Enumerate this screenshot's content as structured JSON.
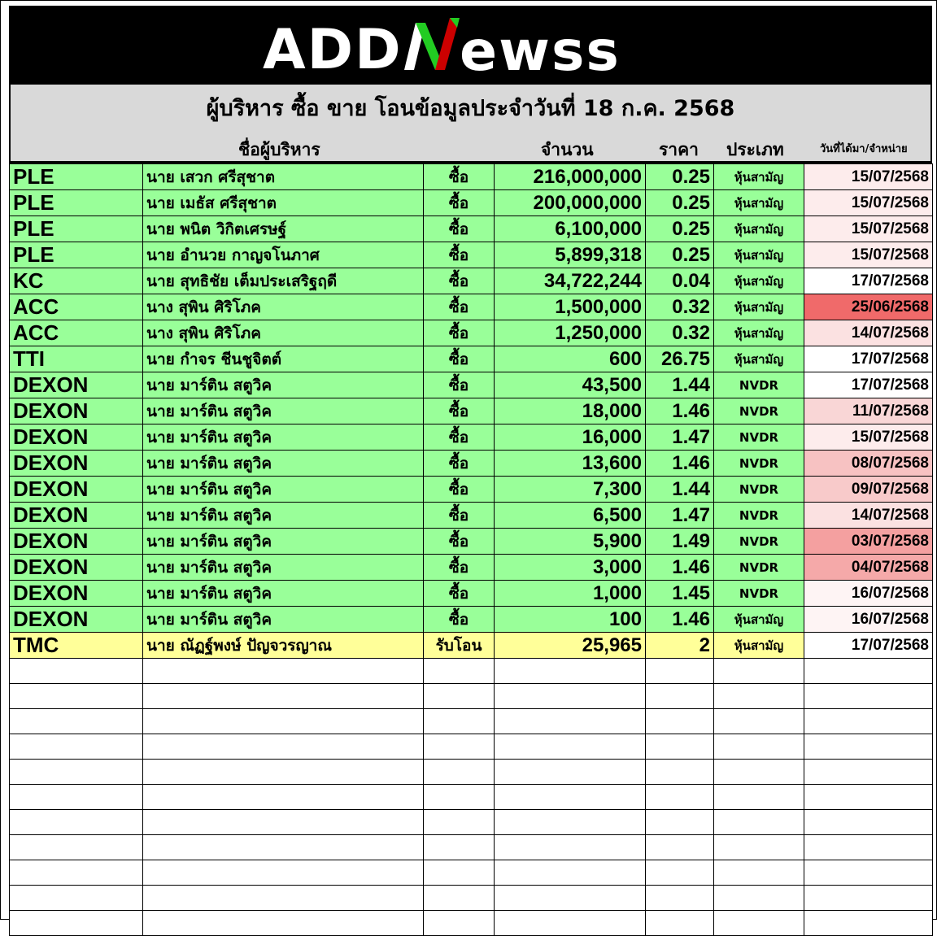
{
  "logo": {
    "text_left": "ADD",
    "text_right": "ewss",
    "colors": {
      "white": "#ffffff",
      "green": "#22cc22",
      "red": "#cc0000"
    }
  },
  "title": "ผู้บริหาร ซื้อ ขาย โอนข้อมูลประจำวันที่ 18 ก.ค. 2568",
  "headers": {
    "name": "ชื่อผู้บริหาร",
    "quantity": "จำนวน",
    "price": "ราคา",
    "type": "ประเภท",
    "date": "วันที่ได้มา/จำหน่าย"
  },
  "colors": {
    "buy_row": "#99ff99",
    "transfer_row": "#ffff99",
    "title_band": "#d9d9d9"
  },
  "rows": [
    {
      "symbol": "PLE",
      "name": "นาย เสวก ศรีสุชาต",
      "action": "ซื้อ",
      "quantity": "216,000,000",
      "price": "0.25",
      "type": "หุ้นสามัญ",
      "date": "15/07/2568",
      "date_color": "#fdecec",
      "kind": "buy"
    },
    {
      "symbol": "PLE",
      "name": "นาย เมธัส ศรีสุชาต",
      "action": "ซื้อ",
      "quantity": "200,000,000",
      "price": "0.25",
      "type": "หุ้นสามัญ",
      "date": "15/07/2568",
      "date_color": "#fdecec",
      "kind": "buy"
    },
    {
      "symbol": "PLE",
      "name": "นาย พนิต วิกิตเศรษฐ์",
      "action": "ซื้อ",
      "quantity": "6,100,000",
      "price": "0.25",
      "type": "หุ้นสามัญ",
      "date": "15/07/2568",
      "date_color": "#fdecec",
      "kind": "buy"
    },
    {
      "symbol": "PLE",
      "name": "นาย อำนวย กาญจโนภาศ",
      "action": "ซื้อ",
      "quantity": "5,899,318",
      "price": "0.25",
      "type": "หุ้นสามัญ",
      "date": "15/07/2568",
      "date_color": "#fdecec",
      "kind": "buy"
    },
    {
      "symbol": "KC",
      "name": "นาย สุทธิชัย เต็มประเสริฐฤดี",
      "action": "ซื้อ",
      "quantity": "34,722,244",
      "price": "0.04",
      "type": "หุ้นสามัญ",
      "date": "17/07/2568",
      "date_color": "#ffffff",
      "kind": "buy"
    },
    {
      "symbol": "ACC",
      "name": "นาง สุพิน ศิริโภค",
      "action": "ซื้อ",
      "quantity": "1,500,000",
      "price": "0.32",
      "type": "หุ้นสามัญ",
      "date": "25/06/2568",
      "date_color": "#f06a6a",
      "kind": "buy"
    },
    {
      "symbol": "ACC",
      "name": "นาง สุพิน ศิริโภค",
      "action": "ซื้อ",
      "quantity": "1,250,000",
      "price": "0.32",
      "type": "หุ้นสามัญ",
      "date": "14/07/2568",
      "date_color": "#fbe1e1",
      "kind": "buy"
    },
    {
      "symbol": "TTI",
      "name": "นาย กำจร ชีนชูจิตต์",
      "action": "ซื้อ",
      "quantity": "600",
      "price": "26.75",
      "type": "หุ้นสามัญ",
      "date": "17/07/2568",
      "date_color": "#ffffff",
      "kind": "buy"
    },
    {
      "symbol": "DEXON",
      "name": "นาย มาร์ติน สตูวิค",
      "action": "ซื้อ",
      "quantity": "43,500",
      "price": "1.44",
      "type": "NVDR",
      "date": "17/07/2568",
      "date_color": "#ffffff",
      "kind": "buy"
    },
    {
      "symbol": "DEXON",
      "name": "นาย มาร์ติน สตูวิค",
      "action": "ซื้อ",
      "quantity": "18,000",
      "price": "1.46",
      "type": "NVDR",
      "date": "11/07/2568",
      "date_color": "#f9d6d6",
      "kind": "buy"
    },
    {
      "symbol": "DEXON",
      "name": "นาย มาร์ติน สตูวิค",
      "action": "ซื้อ",
      "quantity": "16,000",
      "price": "1.47",
      "type": "NVDR",
      "date": "15/07/2568",
      "date_color": "#fdecec",
      "kind": "buy"
    },
    {
      "symbol": "DEXON",
      "name": "นาย มาร์ติน สตูวิค",
      "action": "ซื้อ",
      "quantity": "13,600",
      "price": "1.46",
      "type": "NVDR",
      "date": "08/07/2568",
      "date_color": "#f7c2c2",
      "kind": "buy"
    },
    {
      "symbol": "DEXON",
      "name": "นาย มาร์ติน สตูวิค",
      "action": "ซื้อ",
      "quantity": "7,300",
      "price": "1.44",
      "type": "NVDR",
      "date": "09/07/2568",
      "date_color": "#f8caca",
      "kind": "buy"
    },
    {
      "symbol": "DEXON",
      "name": "นาย มาร์ติน สตูวิค",
      "action": "ซื้อ",
      "quantity": "6,500",
      "price": "1.47",
      "type": "NVDR",
      "date": "14/07/2568",
      "date_color": "#fbe1e1",
      "kind": "buy"
    },
    {
      "symbol": "DEXON",
      "name": "นาย มาร์ติน สตูวิค",
      "action": "ซื้อ",
      "quantity": "5,900",
      "price": "1.49",
      "type": "NVDR",
      "date": "03/07/2568",
      "date_color": "#f4a0a0",
      "kind": "buy"
    },
    {
      "symbol": "DEXON",
      "name": "นาย มาร์ติน สตูวิค",
      "action": "ซื้อ",
      "quantity": "3,000",
      "price": "1.46",
      "type": "NVDR",
      "date": "04/07/2568",
      "date_color": "#f5a9a9",
      "kind": "buy"
    },
    {
      "symbol": "DEXON",
      "name": "นาย มาร์ติน สตูวิค",
      "action": "ซื้อ",
      "quantity": "1,000",
      "price": "1.45",
      "type": "NVDR",
      "date": "16/07/2568",
      "date_color": "#fef4f4",
      "kind": "buy"
    },
    {
      "symbol": "DEXON",
      "name": "นาย มาร์ติน สตูวิค",
      "action": "ซื้อ",
      "quantity": "100",
      "price": "1.46",
      "type": "หุ้นสามัญ",
      "date": "16/07/2568",
      "date_color": "#fef4f4",
      "kind": "buy"
    },
    {
      "symbol": "TMC",
      "name": "นาย ณัฏฐ์พงษ์ ปัญจวรญาณ",
      "action": "รับโอน",
      "quantity": "25,965",
      "price": "2",
      "type": "หุ้นสามัญ",
      "date": "17/07/2568",
      "date_color": "#ffffff",
      "kind": "transfer"
    }
  ],
  "empty_rows": 11
}
